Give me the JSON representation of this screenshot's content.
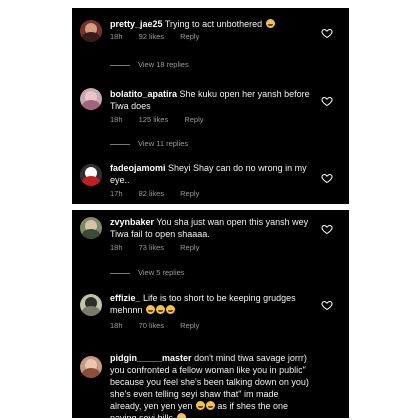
{
  "posts": {
    "top": [
      {
        "username": "pretty_jae25",
        "text": "Trying to act unbothered",
        "time": "18h",
        "likes": "92 likes",
        "reply": "Reply",
        "view_replies": "View 18 replies",
        "emoji": [
          "grinning-sweat"
        ]
      },
      {
        "username": "bolatito_apatira",
        "text": "She kuku open her yansh before Tiwa does",
        "time": "18h",
        "likes": "125 likes",
        "reply": "Reply",
        "view_replies": "View 11 replies",
        "emoji": []
      },
      {
        "username": "fadeojamomi",
        "text": "Sheyi Shay can do no wrong in my eye..",
        "time": "17h",
        "likes": "82 likes",
        "reply": "Reply",
        "emoji": []
      }
    ],
    "bottom": [
      {
        "username": "zvynbaker",
        "text": "You sha just wan open this yansh wey Tiwa fail to open shaaaa.",
        "time": "18h",
        "likes": "73 likes",
        "reply": "Reply",
        "view_replies": "View 5 replies",
        "emoji": []
      },
      {
        "username": "effizie_",
        "text": "Life is too short to be keeping grudges mehnnn",
        "time": "18h",
        "likes": "70 likes",
        "reply": "Reply",
        "emoji": [
          "grinning",
          "grinning",
          "grinning"
        ]
      },
      {
        "username": "pidgin_____master",
        "text_1": "don't mind tiwa savage jorrr) you confronted a fellow woman like you in public\" because you feel she's been talking down on you) she's even telling seyi shaw that\" im made already, yen yen yen",
        "text_2": "as if shes the  one  paying seyi bills",
        "emoji": [
          "grinning",
          "grinning",
          "grinning"
        ]
      }
    ]
  },
  "icons": {
    "heart": "heart-outline-icon"
  },
  "colors": {
    "panel_bg": "#000000",
    "meta_text": "#9a9a9a",
    "emoji": "#f5c542"
  }
}
